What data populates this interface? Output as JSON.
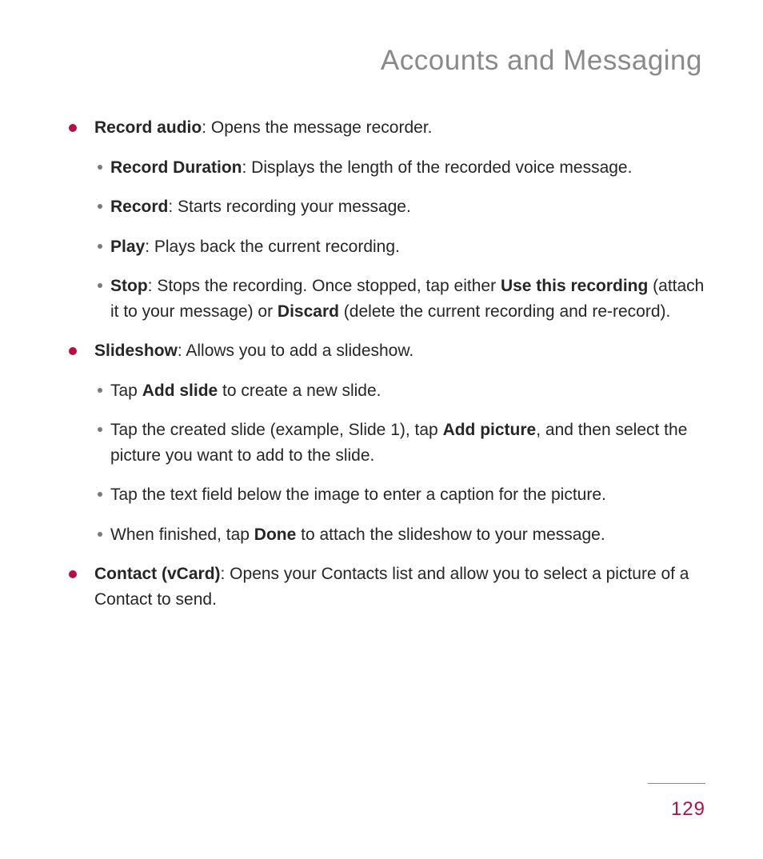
{
  "header": {
    "title": "Accounts and Messaging"
  },
  "content": {
    "items": [
      {
        "lead": "Record audio",
        "rest": ": Opens the message recorder.",
        "subs": [
          {
            "lead": "Record Duration",
            "rest": ": Displays the length of the recorded voice message."
          },
          {
            "lead": "Record",
            "rest": ": Starts recording your message."
          },
          {
            "lead": "Play",
            "rest": ": Plays back the current recording."
          },
          {
            "lead": "Stop",
            "parts": [
              ": Stops the recording. Once stopped, tap either ",
              {
                "b": "Use this recording"
              },
              " (attach it to your message) or ",
              {
                "b": "Discard"
              },
              " (delete the current recording and re-record)."
            ]
          }
        ]
      },
      {
        "lead": "Slideshow",
        "rest": ": Allows you to add a slideshow.",
        "subs": [
          {
            "parts": [
              "Tap ",
              {
                "b": "Add slide"
              },
              " to create a new slide."
            ]
          },
          {
            "parts": [
              "Tap the created slide (example, Slide 1), tap ",
              {
                "b": "Add picture"
              },
              ", and then select the picture you want to add to the slide."
            ]
          },
          {
            "parts": [
              "Tap the text field below the image to enter a caption for the picture."
            ]
          },
          {
            "parts": [
              "When finished, tap ",
              {
                "b": "Done"
              },
              " to attach the slideshow to your message."
            ]
          }
        ]
      },
      {
        "lead": "Contact (vCard)",
        "rest": ": Opens your Contacts list and allow you to select a picture of a Contact to send."
      }
    ]
  },
  "footer": {
    "page_number": "129"
  }
}
